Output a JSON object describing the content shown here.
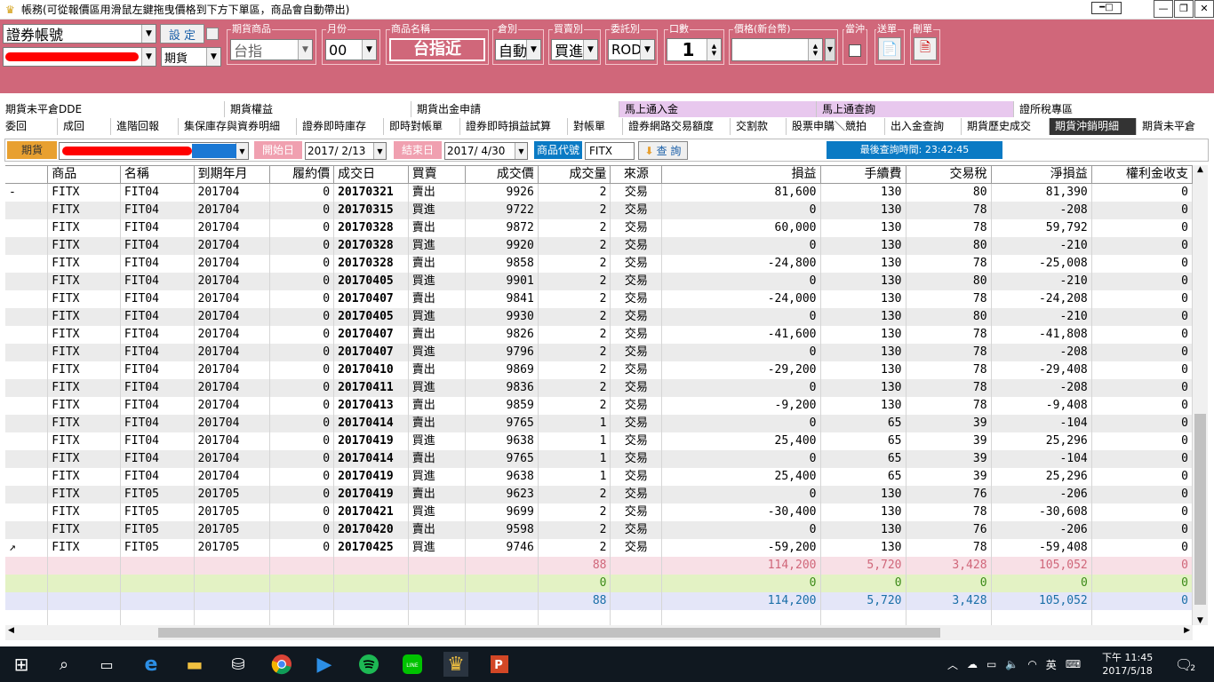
{
  "window": {
    "title": "帳務(可從報價區用滑鼠左鍵拖曳價格到下方下單區，商品會自動帶出)",
    "controls": {
      "minimize": "—",
      "restore": "❐",
      "close": "✕"
    }
  },
  "order_panel": {
    "account_select": "證券帳號",
    "set_button": "設 定",
    "type_select": "期貨",
    "futures_product_label": "期貨商品",
    "futures_product_value": "台指",
    "month_label": "月份",
    "month_value": "00",
    "product_name_label": "商品名稱",
    "product_name_value": "台指近",
    "category_label": "倉別",
    "category_value": "自動",
    "side_label": "買賣別",
    "side_value": "買進",
    "order_type_label": "委託別",
    "order_type_value": "ROD",
    "lots_label": "口數",
    "lots_value": "1",
    "price_label": "價格(新台幣)",
    "price_value": "",
    "daytrade_label": "當沖",
    "send_label": "送單",
    "delete_label": "刪單"
  },
  "tabs_row1": [
    "期貨未平倉DDE",
    "期貨權益",
    "期貨出金申請",
    "馬上通入金",
    "馬上通查詢",
    "證所稅專區"
  ],
  "tabs_row2": [
    "委回",
    "成回",
    "進階回報",
    "集保庫存與資券明細",
    "證券即時庫存",
    "即時對帳單",
    "證券即時損益試算",
    "對帳單",
    "證券網路交易額度",
    "交割款",
    "股票申購＼競拍",
    "出入金查詢",
    "期貨歷史成交",
    "期貨沖銷明細",
    "期貨未平倉"
  ],
  "active_tab": "期貨沖銷明細",
  "query_bar": {
    "futures_pill": "期貨",
    "start_label": "開始日",
    "start_date": "2017/ 2/13",
    "end_label": "結束日",
    "end_date": "2017/ 4/30",
    "code_label": "商品代號",
    "code_value": "FITX",
    "query_button": "查 詢",
    "last_query": "最後查詢時間: 23:42:45"
  },
  "grid": {
    "columns": [
      "",
      "商品",
      "名稱",
      "到期年月",
      "履約價",
      "成交日",
      "買賣",
      "成交價",
      "成交量",
      "來源",
      "損益",
      "手續費",
      "交易稅",
      "淨損益",
      "權利金收支"
    ],
    "rows": [
      [
        "-",
        "FITX",
        "FIT04",
        "201704",
        "0",
        "20170321",
        "賣出",
        "9926",
        "2",
        "交易",
        "81,600",
        "130",
        "80",
        "81,390",
        "0"
      ],
      [
        "",
        "FITX",
        "FIT04",
        "201704",
        "0",
        "20170315",
        "買進",
        "9722",
        "2",
        "交易",
        "0",
        "130",
        "78",
        "-208",
        "0"
      ],
      [
        "",
        "FITX",
        "FIT04",
        "201704",
        "0",
        "20170328",
        "賣出",
        "9872",
        "2",
        "交易",
        "60,000",
        "130",
        "78",
        "59,792",
        "0"
      ],
      [
        "",
        "FITX",
        "FIT04",
        "201704",
        "0",
        "20170328",
        "買進",
        "9920",
        "2",
        "交易",
        "0",
        "130",
        "80",
        "-210",
        "0"
      ],
      [
        "",
        "FITX",
        "FIT04",
        "201704",
        "0",
        "20170328",
        "賣出",
        "9858",
        "2",
        "交易",
        "-24,800",
        "130",
        "78",
        "-25,008",
        "0"
      ],
      [
        "",
        "FITX",
        "FIT04",
        "201704",
        "0",
        "20170405",
        "買進",
        "9901",
        "2",
        "交易",
        "0",
        "130",
        "80",
        "-210",
        "0"
      ],
      [
        "",
        "FITX",
        "FIT04",
        "201704",
        "0",
        "20170407",
        "賣出",
        "9841",
        "2",
        "交易",
        "-24,000",
        "130",
        "78",
        "-24,208",
        "0"
      ],
      [
        "",
        "FITX",
        "FIT04",
        "201704",
        "0",
        "20170405",
        "買進",
        "9930",
        "2",
        "交易",
        "0",
        "130",
        "80",
        "-210",
        "0"
      ],
      [
        "",
        "FITX",
        "FIT04",
        "201704",
        "0",
        "20170407",
        "賣出",
        "9826",
        "2",
        "交易",
        "-41,600",
        "130",
        "78",
        "-41,808",
        "0"
      ],
      [
        "",
        "FITX",
        "FIT04",
        "201704",
        "0",
        "20170407",
        "買進",
        "9796",
        "2",
        "交易",
        "0",
        "130",
        "78",
        "-208",
        "0"
      ],
      [
        "",
        "FITX",
        "FIT04",
        "201704",
        "0",
        "20170410",
        "賣出",
        "9869",
        "2",
        "交易",
        "-29,200",
        "130",
        "78",
        "-29,408",
        "0"
      ],
      [
        "",
        "FITX",
        "FIT04",
        "201704",
        "0",
        "20170411",
        "買進",
        "9836",
        "2",
        "交易",
        "0",
        "130",
        "78",
        "-208",
        "0"
      ],
      [
        "",
        "FITX",
        "FIT04",
        "201704",
        "0",
        "20170413",
        "賣出",
        "9859",
        "2",
        "交易",
        "-9,200",
        "130",
        "78",
        "-9,408",
        "0"
      ],
      [
        "",
        "FITX",
        "FIT04",
        "201704",
        "0",
        "20170414",
        "賣出",
        "9765",
        "1",
        "交易",
        "0",
        "65",
        "39",
        "-104",
        "0"
      ],
      [
        "",
        "FITX",
        "FIT04",
        "201704",
        "0",
        "20170419",
        "買進",
        "9638",
        "1",
        "交易",
        "25,400",
        "65",
        "39",
        "25,296",
        "0"
      ],
      [
        "",
        "FITX",
        "FIT04",
        "201704",
        "0",
        "20170414",
        "賣出",
        "9765",
        "1",
        "交易",
        "0",
        "65",
        "39",
        "-104",
        "0"
      ],
      [
        "",
        "FITX",
        "FIT04",
        "201704",
        "0",
        "20170419",
        "買進",
        "9638",
        "1",
        "交易",
        "25,400",
        "65",
        "39",
        "25,296",
        "0"
      ],
      [
        "",
        "FITX",
        "FIT05",
        "201705",
        "0",
        "20170419",
        "賣出",
        "9623",
        "2",
        "交易",
        "0",
        "130",
        "76",
        "-206",
        "0"
      ],
      [
        "",
        "FITX",
        "FIT05",
        "201705",
        "0",
        "20170421",
        "買進",
        "9699",
        "2",
        "交易",
        "-30,400",
        "130",
        "78",
        "-30,608",
        "0"
      ],
      [
        "",
        "FITX",
        "FIT05",
        "201705",
        "0",
        "20170420",
        "賣出",
        "9598",
        "2",
        "交易",
        "0",
        "130",
        "76",
        "-206",
        "0"
      ],
      [
        "↗",
        "FITX",
        "FIT05",
        "201705",
        "0",
        "20170425",
        "買進",
        "9746",
        "2",
        "交易",
        "-59,200",
        "130",
        "78",
        "-59,408",
        "0"
      ]
    ],
    "summary": [
      {
        "qty": "88",
        "pnl": "114,200",
        "fee": "5,720",
        "tax": "3,428",
        "net": "105,052",
        "premium": "0"
      },
      {
        "qty": "0",
        "pnl": "0",
        "fee": "0",
        "tax": "0",
        "net": "0",
        "premium": "0"
      },
      {
        "qty": "88",
        "pnl": "114,200",
        "fee": "5,720",
        "tax": "3,428",
        "net": "105,052",
        "premium": "0"
      }
    ]
  },
  "taskbar": {
    "ime": "英",
    "time": "下午 11:45",
    "date": "2017/5/18",
    "notify_count": "2"
  },
  "colors": {
    "panel": "#d0677a",
    "accent_orange": "#e8a030",
    "query_blue": "#0a7ac4"
  }
}
